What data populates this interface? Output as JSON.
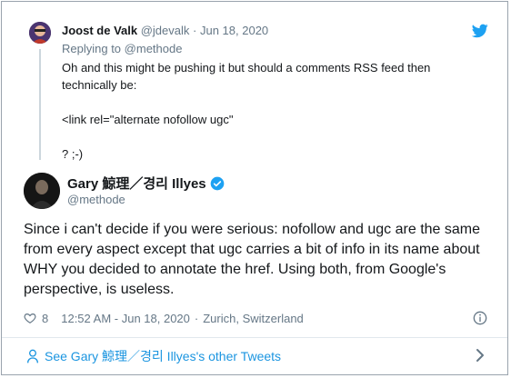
{
  "reply_tweet": {
    "author_name": "Joost de Valk",
    "author_handle": "@jdevalk",
    "separator": "·",
    "date": "Jun 18, 2020",
    "replying_label": "Replying to",
    "replying_to": "@methode",
    "lines": [
      "Oh and this might be pushing it but should a comments RSS feed then",
      "technically be:",
      "<link rel=\"alternate nofollow ugc\"",
      "? ;-)"
    ],
    "brand_icon": "twitter-bird-icon"
  },
  "main_tweet": {
    "author_name": "Gary 鯨理／경리 Illyes",
    "author_handle": "@methode",
    "verified": true,
    "text": "Since i can't decide if you were serious: nofollow and ugc are the same from every aspect except that ugc carries a bit of info in its name about WHY you decided to annotate the href. Using both, from Google's perspective, is useless.",
    "like_count": "8",
    "time": "12:52 AM - Jun 18, 2020",
    "separator": "·",
    "location": "Zurich, Switzerland"
  },
  "footer": {
    "link_text": "See Gary 鯨理／경리 Illyes's other Tweets"
  },
  "colors": {
    "accent": "#1da1f2",
    "link": "#1b95e0",
    "muted": "#657786",
    "text": "#14171a",
    "border": "#9aa3ad"
  }
}
